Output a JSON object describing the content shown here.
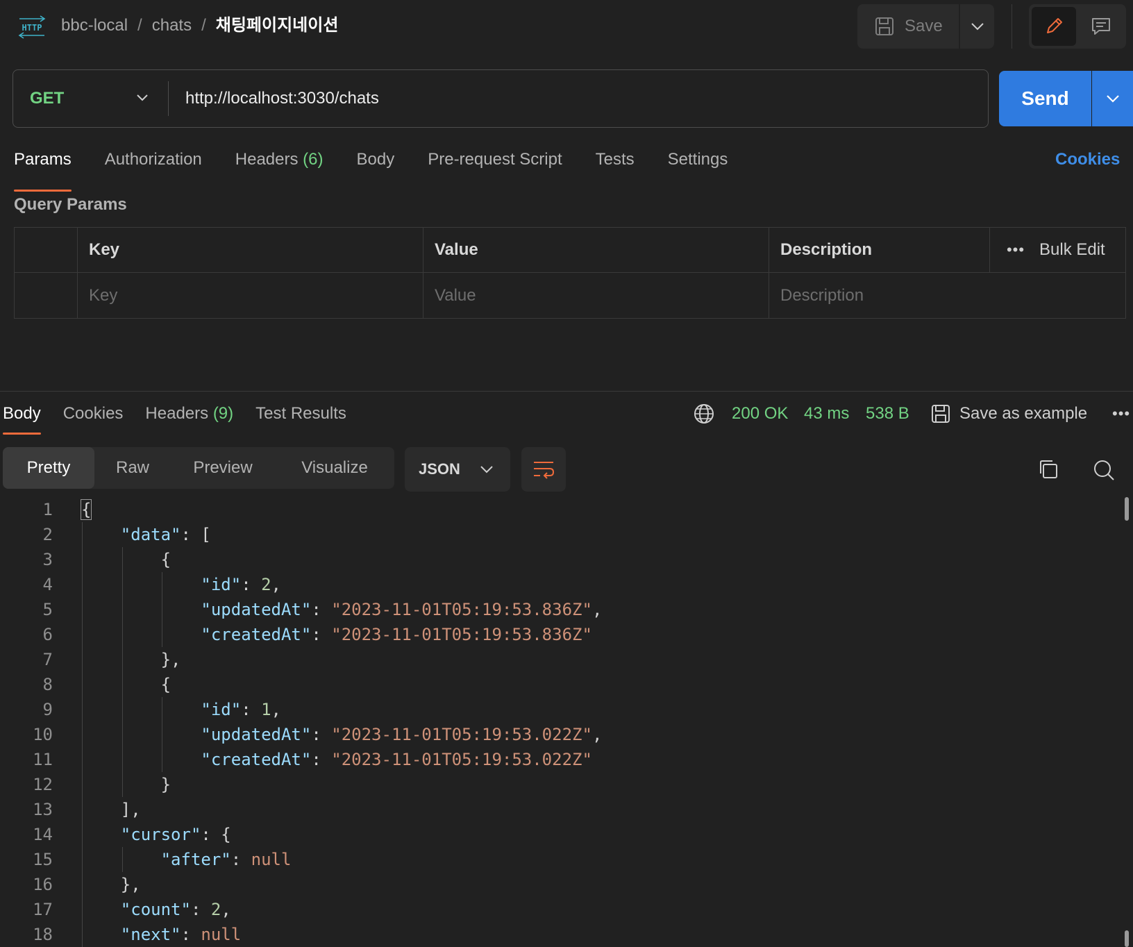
{
  "breadcrumb": {
    "icon": "http-icon",
    "items": [
      "bbc-local",
      "chats"
    ],
    "separator": "/",
    "current": "채팅페이지네이션"
  },
  "toolbar": {
    "save_label": "Save"
  },
  "request": {
    "method": "GET",
    "url": "http://localhost:3030/chats",
    "send_label": "Send"
  },
  "request_tabs": {
    "params": "Params",
    "authorization": "Authorization",
    "headers": "Headers",
    "headers_count": "(6)",
    "body": "Body",
    "prerequest": "Pre-request Script",
    "tests": "Tests",
    "settings": "Settings",
    "cookies": "Cookies"
  },
  "query_params": {
    "title": "Query Params",
    "headers": {
      "key": "Key",
      "value": "Value",
      "description": "Description"
    },
    "bulk_edit": "Bulk Edit",
    "placeholders": {
      "key": "Key",
      "value": "Value",
      "description": "Description"
    }
  },
  "response": {
    "tabs": {
      "body": "Body",
      "cookies": "Cookies",
      "headers": "Headers",
      "headers_count": "(9)",
      "test_results": "Test Results"
    },
    "status": "200 OK",
    "time": "43 ms",
    "size": "538 B",
    "save_example": "Save as example",
    "views": [
      "Pretty",
      "Raw",
      "Preview",
      "Visualize"
    ],
    "format": "JSON"
  },
  "colors": {
    "accent": "#ef6b3b",
    "send": "#2f7be0",
    "success": "#72d383",
    "link": "#3f8ee8"
  },
  "code_lines": [
    "{",
    "    \"data\": [",
    "        {",
    "            \"id\": 2,",
    "            \"updatedAt\": \"2023-11-01T05:19:53.836Z\",",
    "            \"createdAt\": \"2023-11-01T05:19:53.836Z\"",
    "        },",
    "        {",
    "            \"id\": 1,",
    "            \"updatedAt\": \"2023-11-01T05:19:53.022Z\",",
    "            \"createdAt\": \"2023-11-01T05:19:53.022Z\"",
    "        }",
    "    ],",
    "    \"cursor\": {",
    "        \"after\": null",
    "    },",
    "    \"count\": 2,",
    "    \"next\": null"
  ]
}
